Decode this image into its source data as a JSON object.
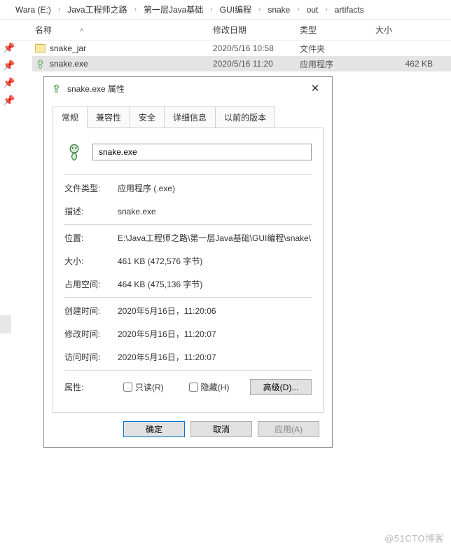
{
  "breadcrumb": [
    "Wara (E:)",
    "Java工程师之路",
    "第一层Java基础",
    "GUI编程",
    "snake",
    "out",
    "artifacts"
  ],
  "columns": {
    "name": "名称",
    "date": "修改日期",
    "type": "类型",
    "size": "大小"
  },
  "rows": [
    {
      "icon": "folder",
      "name": "snake_jar",
      "date": "2020/5/16 10:58",
      "type": "文件夹",
      "size": ""
    },
    {
      "icon": "snake",
      "name": "snake.exe",
      "date": "2020/5/16 11:20",
      "type": "应用程序",
      "size": "462 KB",
      "selected": true
    }
  ],
  "dialog": {
    "title": "snake.exe 属性",
    "tabs": [
      "常规",
      "兼容性",
      "安全",
      "详细信息",
      "以前的版本"
    ],
    "activeTab": 0,
    "filename": "snake.exe",
    "fields": {
      "fileTypeLabel": "文件类型:",
      "fileType": "应用程序 (.exe)",
      "descLabel": "描述:",
      "desc": "snake.exe",
      "locationLabel": "位置:",
      "location": "E:\\Java工程师之路\\第一层Java基础\\GUI编程\\snake\\",
      "sizeLabel": "大小:",
      "size": "461 KB (472,576 字节)",
      "diskLabel": "占用空间:",
      "disk": "464 KB (475,136 字节)",
      "createdLabel": "创建时间:",
      "created": "2020年5月16日，11:20:06",
      "modifiedLabel": "修改时间:",
      "modified": "2020年5月16日，11:20:07",
      "accessedLabel": "访问时间:",
      "accessed": "2020年5月16日，11:20:07",
      "attrLabel": "属性:",
      "readonly": "只读(R)",
      "hidden": "隐藏(H)",
      "advanced": "高级(D)..."
    },
    "buttons": {
      "ok": "确定",
      "cancel": "取消",
      "apply": "应用(A)"
    }
  },
  "watermark": "@51CTO博客"
}
